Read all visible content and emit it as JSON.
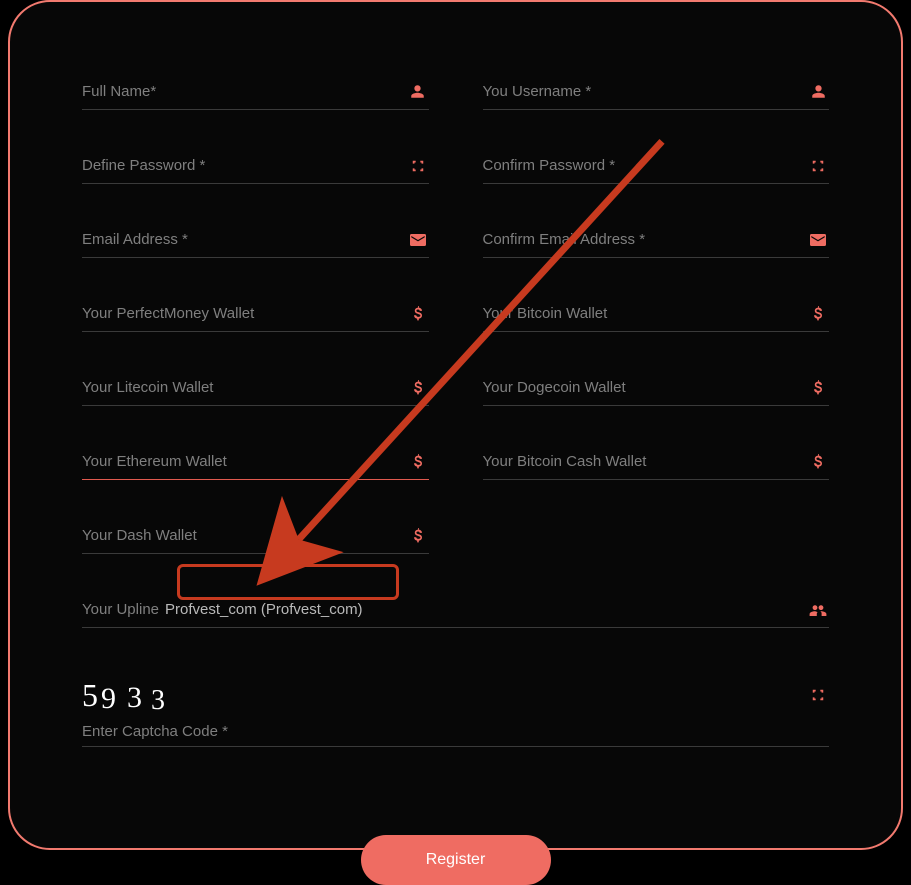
{
  "fields": {
    "full_name": {
      "placeholder": "Full Name*"
    },
    "username": {
      "placeholder": "You Username *"
    },
    "password": {
      "placeholder": "Define Password *"
    },
    "confirm_password": {
      "placeholder": "Confirm Password *"
    },
    "email": {
      "placeholder": "Email Address *"
    },
    "confirm_email": {
      "placeholder": "Confirm Email Address *"
    },
    "perfectmoney": {
      "placeholder": "Your PerfectMoney Wallet"
    },
    "bitcoin": {
      "placeholder": "Your Bitcoin Wallet"
    },
    "litecoin": {
      "placeholder": "Your Litecoin Wallet"
    },
    "dogecoin": {
      "placeholder": "Your Dogecoin Wallet"
    },
    "ethereum": {
      "placeholder": "Your Ethereum Wallet"
    },
    "bitcoin_cash": {
      "placeholder": "Your Bitcoin Cash Wallet"
    },
    "dash": {
      "placeholder": "Your Dash Wallet"
    }
  },
  "upline": {
    "label": "Your Upline",
    "value": "Profvest_com (Profvest_com)"
  },
  "captcha": {
    "d1": "5",
    "d2": "9",
    "d3": "3",
    "d4": "3",
    "label": "Enter Captcha Code *"
  },
  "register_label": "Register"
}
